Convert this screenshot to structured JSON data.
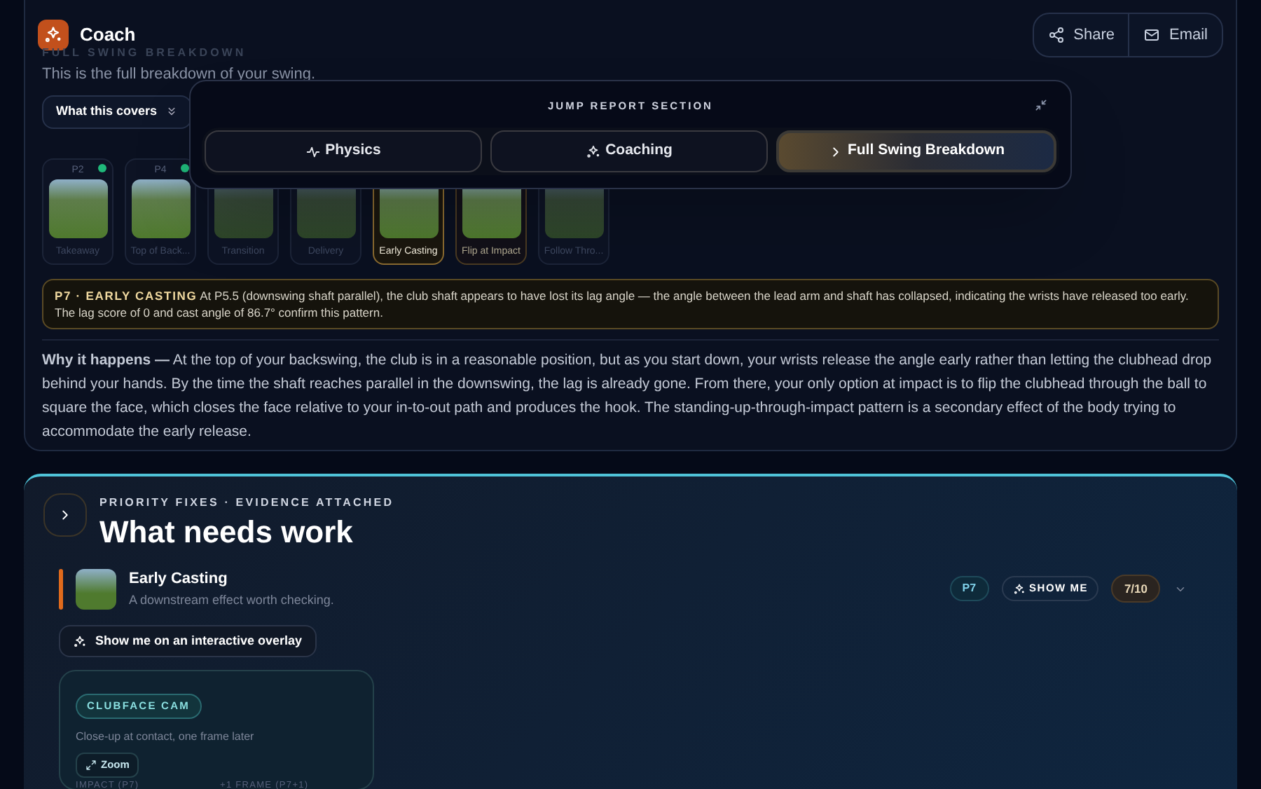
{
  "header": {
    "title": "Coach",
    "actions": [
      "Share",
      "Email"
    ]
  },
  "breakdown": {
    "label": "FULL SWING BREAKDOWN",
    "subtitle": "This is the full breakdown of your swing.",
    "covers_button": "What this covers",
    "frames": [
      {
        "label": "P2",
        "caption": "Takeaway",
        "dot": true,
        "selected": false,
        "flagged": false
      },
      {
        "label": "P4",
        "caption": "Top of Back...",
        "dot": true,
        "selected": false,
        "flagged": false
      },
      {
        "caption": "Transition",
        "selected": false,
        "flagged": false
      },
      {
        "caption": "Delivery",
        "selected": false,
        "flagged": false
      },
      {
        "caption": "Early Casting",
        "selected": true,
        "flagged": true
      },
      {
        "caption": "Flip at Impact",
        "selected": false,
        "flagged": true
      },
      {
        "caption": "Follow Thro...",
        "selected": false,
        "flagged": false
      }
    ],
    "callout": {
      "tag": "P7 · EARLY CASTING",
      "text": "At P5.5 (downswing shaft parallel), the club shaft appears to have lost its lag angle — the angle between the lead arm and shaft has collapsed, indicating the wrists have released too early. The lag score of 0 and cast angle of 86.7° confirm this pattern."
    },
    "why": "**Why it happens —** At the top of your backswing, the club is in a reasonable position, but as you start down, your wrists release the angle early rather than letting the clubhead drop behind your hands. By the time the shaft reaches parallel in the downswing, the lag is already gone. From there, your only option at impact is to flip the clubhead through the ball to square the face, which closes the face relative to your in-to-out path and produces the hook. The standing-up-through-impact pattern is a secondary effect of the body trying to accommodate the early release."
  },
  "jump_panel": {
    "title": "JUMP REPORT SECTION",
    "tabs": [
      {
        "kind": "physics",
        "label": "Physics",
        "selected": false
      },
      {
        "kind": "coaching",
        "label": "Coaching",
        "selected": false
      },
      {
        "kind": "chevron",
        "label": "Full Swing Breakdown",
        "selected": true
      }
    ]
  },
  "priority": {
    "eyebrow": "PRIORITY FIXES · EVIDENCE ATTACHED",
    "title": "What needs work",
    "fix": {
      "title": "Early Casting",
      "subtitle": "A downstream effect worth checking.",
      "position": "P7",
      "show_me": "SHOW ME",
      "score": "7/10",
      "expanded": false
    },
    "overlay_button": "Show me on an interactive overlay",
    "evidence": {
      "tag": "CLUBFACE CAM",
      "caption": "Close-up at contact, one frame later",
      "zoom": "Zoom",
      "frame_labels": [
        "IMPACT (P7)",
        "+1 FRAME (P7+1)"
      ]
    }
  }
}
